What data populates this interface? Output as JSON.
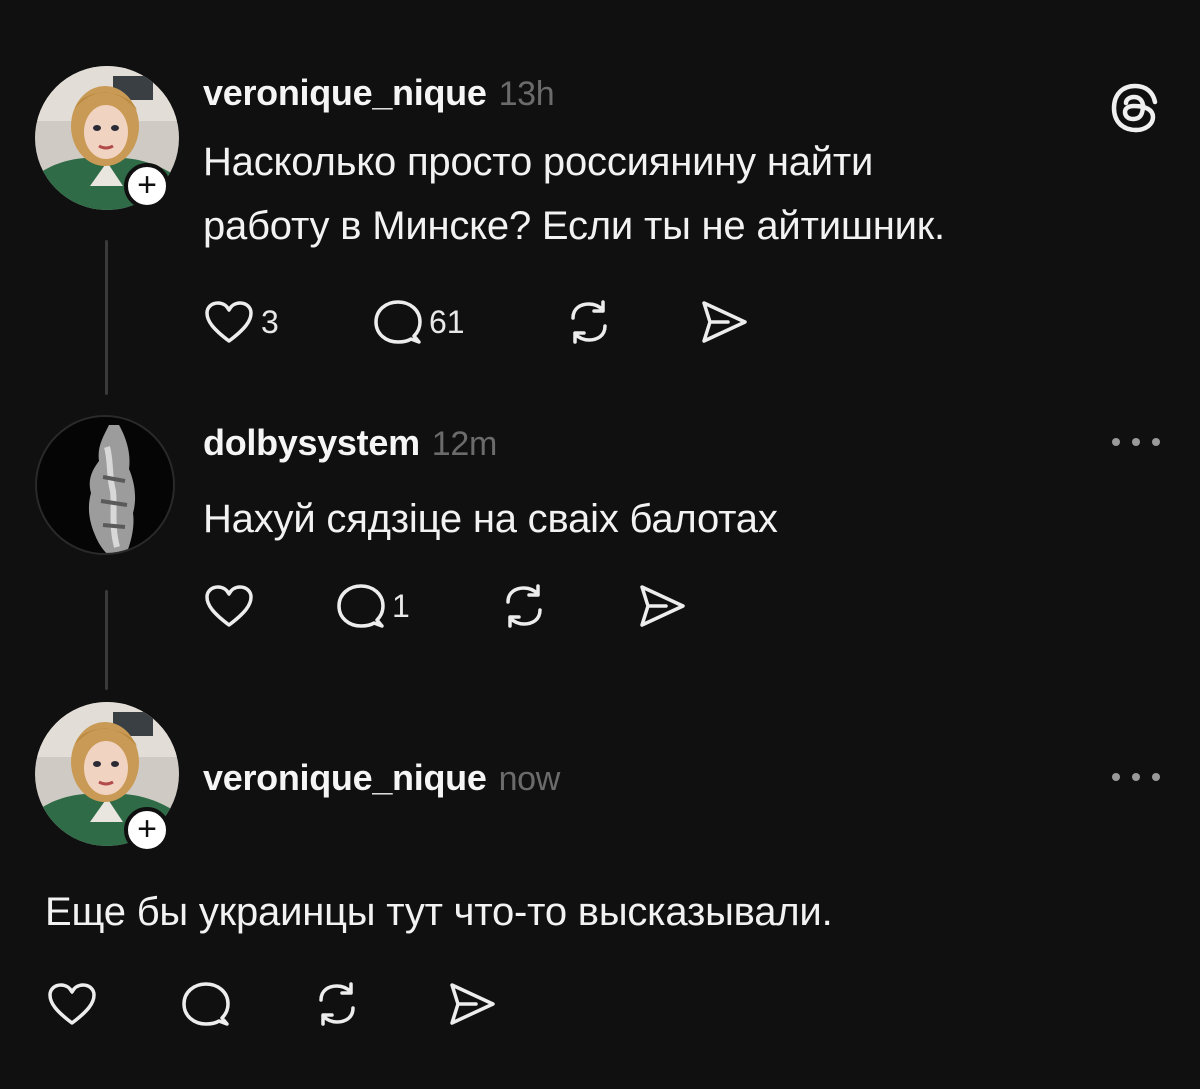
{
  "posts": [
    {
      "username": "veronique_nique",
      "time": "13h",
      "text_line1": "Насколько просто россиянину найти",
      "text_line2": "работу в Минске? Если ты не айтишник.",
      "likes": "3",
      "replies": "61",
      "avatar_icon": "user-avatar-icon",
      "follow_badge": "+"
    },
    {
      "username": "dolbysystem",
      "time": "12m",
      "text": "Нахуй сядзіце на сваіх балотах",
      "likes": "",
      "replies": "1",
      "avatar_icon": "user-avatar-icon"
    },
    {
      "username": "veronique_nique",
      "time": "now",
      "text": "Еще бы украинцы тут что-то высказывали.",
      "likes": "",
      "replies": "",
      "avatar_icon": "user-avatar-icon",
      "follow_badge": "+"
    }
  ],
  "icons": {
    "app_logo": "threads-logo-icon",
    "more": "more-options-icon",
    "like": "heart-icon",
    "reply": "comment-icon",
    "repost": "repost-icon",
    "share": "share-icon"
  },
  "colors": {
    "background": "#101010",
    "text": "#f2f2f2",
    "muted": "#6b6b6b",
    "thread_line": "#3a3a3a"
  }
}
